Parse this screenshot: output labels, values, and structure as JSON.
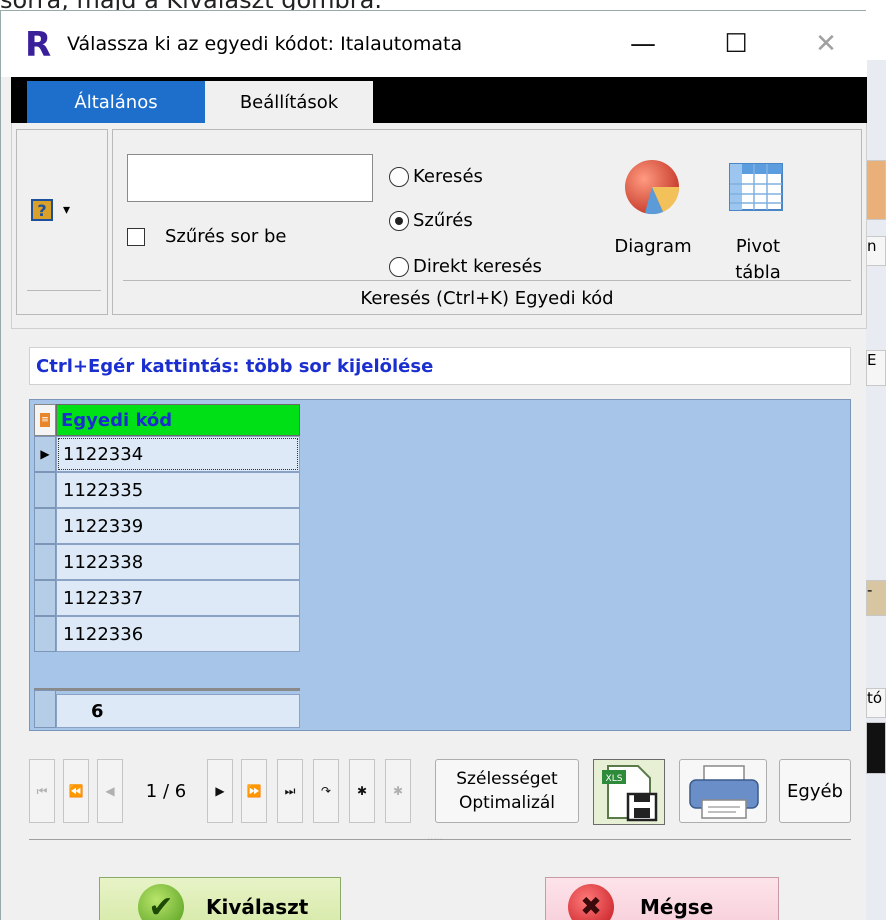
{
  "background": {
    "caption_fragment": "sorra, majd a Kiválaszt gombra.",
    "side_fragments": [
      "n",
      "E",
      "-",
      "tó"
    ]
  },
  "window": {
    "app_logo": "R",
    "title": "Válassza ki az egyedi kódot: Italautomata",
    "minimize_glyph": "—",
    "maximize_glyph": "☐",
    "close_glyph": "✕"
  },
  "tabs": [
    {
      "label": "Általános",
      "active": true
    },
    {
      "label": "Beállítások",
      "active": false
    }
  ],
  "ribbon": {
    "help_icon": "help-book-icon",
    "help_glyph": "?",
    "help_caret": "▾",
    "search_value": "",
    "filter_row_label": "Szűrés sor be",
    "filter_row_checked": false,
    "radio_options": [
      {
        "label": "Keresés",
        "selected": false
      },
      {
        "label": "Szűrés",
        "selected": true
      },
      {
        "label": "Direkt keresés",
        "selected": false
      }
    ],
    "diagram_label": "Diagram",
    "pivot_label_line1": "Pivot",
    "pivot_label_line2": "tábla",
    "group_label": "Keresés (Ctrl+K) Egyedi kód"
  },
  "hint": "Ctrl+Egér kattintás: több sor kijelölése",
  "grid": {
    "column_header": "Egyedi kód",
    "rows": [
      "1122334",
      "1122335",
      "1122339",
      "1122338",
      "1122337",
      "1122336"
    ],
    "current_row_marker": "▶",
    "footer_count": "6",
    "header_color": "#00e016",
    "header_text_color": "#1b2fd0"
  },
  "navigator": {
    "first_glyph": "⏮",
    "prev_page_glyph": "⏪",
    "prev_glyph": "◀",
    "position": "1 / 6",
    "next_glyph": "▶",
    "next_page_glyph": "⏩",
    "last_glyph": "⏭",
    "refresh_glyph": "↷",
    "new_glyph": "✱",
    "new_disabled_glyph": "✱",
    "width_opt_line1": "Szélességet",
    "width_opt_line2": "Optimalizál",
    "other_label": "Egyéb"
  },
  "buttons": {
    "select_label": "Kiválaszt",
    "select_glyph": "✔",
    "cancel_label": "Mégse",
    "cancel_glyph": "✖"
  },
  "colors": {
    "active_tab": "#1e6fcc",
    "hint_text": "#1b2fd0",
    "grid_background": "#a7c5e8"
  }
}
